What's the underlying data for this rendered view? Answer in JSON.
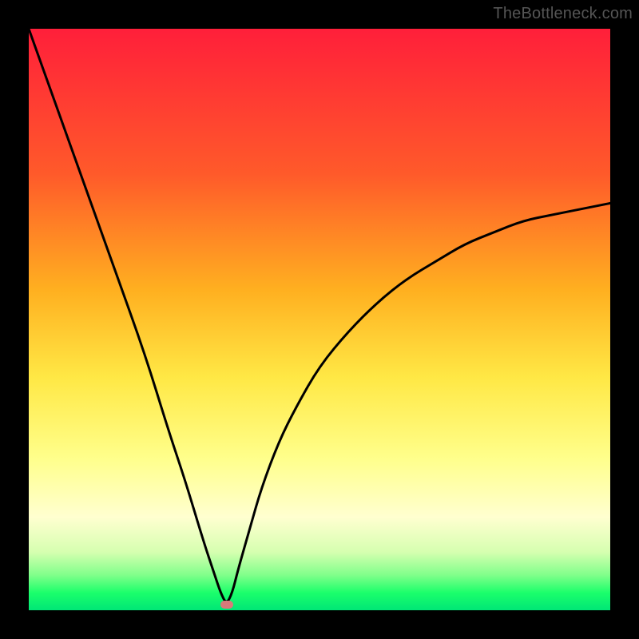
{
  "watermark": "TheBottleneck.com",
  "colors": {
    "gradient_top": "#ff1f3a",
    "gradient_bottom": "#00e676",
    "curve": "#000000",
    "dot": "#d97a7a",
    "frame": "#000000"
  },
  "chart_data": {
    "type": "line",
    "title": "",
    "xlabel": "",
    "ylabel": "",
    "xlim": [
      0,
      100
    ],
    "ylim": [
      0,
      100
    ],
    "notes": "Decorative bottleneck chart with red→green vertical gradient background. Single black curve with a sharp minimum near x≈34 at y≈1; left branch rises to the top-left corner (y≈100 at x≈0) and the right branch rises asymptotically toward y≈70 at x=100. A small pink marker sits at the curve minimum. No axis ticks or labels are rendered.",
    "series": [
      {
        "name": "bottleneck-curve",
        "x": [
          0,
          5,
          10,
          15,
          20,
          24,
          27,
          30,
          32,
          33,
          34,
          35,
          36,
          38,
          40,
          43,
          46,
          50,
          55,
          60,
          65,
          70,
          75,
          80,
          85,
          90,
          95,
          100
        ],
        "y": [
          100,
          86,
          72,
          58,
          44,
          31,
          22,
          12,
          6,
          3,
          1,
          3,
          7,
          14,
          21,
          29,
          35,
          42,
          48,
          53,
          57,
          60,
          63,
          65,
          67,
          68,
          69,
          70
        ]
      }
    ],
    "marker": {
      "x": 34,
      "y": 1
    }
  }
}
